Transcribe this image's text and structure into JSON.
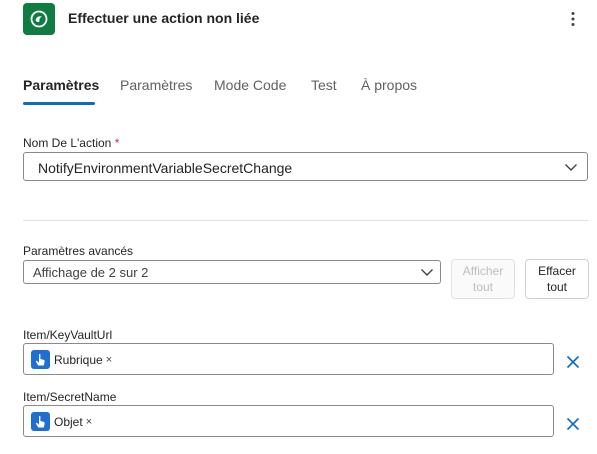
{
  "header": {
    "title": "Effectuer une action non liée",
    "app_icon": "dataverse-icon",
    "more_icon": "more-vertical-icon"
  },
  "tabs": [
    {
      "label": "Paramètres",
      "active": true
    },
    {
      "label": "Paramètres",
      "active": false
    },
    {
      "label": "Mode Code",
      "active": false
    },
    {
      "label": "Test",
      "active": false
    },
    {
      "label": "À propos",
      "active": false
    }
  ],
  "action": {
    "label": "Nom De L'action",
    "required_mark": "*",
    "value": "NotifyEnvironmentVariableSecretChange"
  },
  "advanced": {
    "label": "Paramètres avancés",
    "value": "Affichage de 2 sur 2",
    "show_all_line1": "Afficher",
    "show_all_line2": "tout",
    "clear_all_line1": "Effacer",
    "clear_all_line2": "tout"
  },
  "fields": [
    {
      "label": "Item/KeyVaultUrl",
      "token": "Rubrique",
      "token_remove": "×"
    },
    {
      "label": "Item/SecretName",
      "token": "Objet",
      "token_remove": "×"
    }
  ],
  "colors": {
    "accent": "#0f6cbd",
    "app_icon_bg": "#107c41",
    "token_icon_bg": "#1f6fd1",
    "required": "#c4314b"
  }
}
